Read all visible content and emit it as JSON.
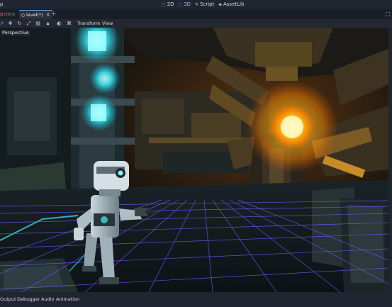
{
  "topbar": {
    "menu_fragment": "p",
    "modes": [
      "2D",
      "3D",
      "Script",
      "AssetLib"
    ],
    "active_mode": "3D"
  },
  "tabs": [
    {
      "label": "Intro",
      "active": false
    },
    {
      "label": "level(*)",
      "active": true
    }
  ],
  "toolbar": {
    "menus": [
      "Transform",
      "View"
    ]
  },
  "viewport": {
    "perspective_label": "Perspective"
  },
  "bottom_panel": {
    "tabs": [
      "Output",
      "Debugger",
      "Audio",
      "Animation"
    ]
  },
  "colors": {
    "accent": "#6f9fe8",
    "grid": "#6a5cff",
    "glow_cyan": "#3ff2ff",
    "glow_orange": "#ffb21a"
  }
}
